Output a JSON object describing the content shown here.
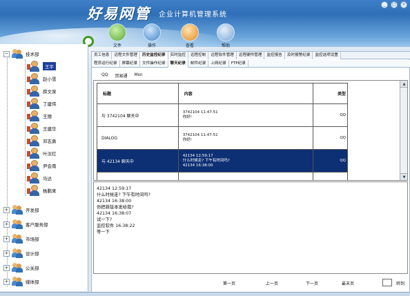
{
  "app": {
    "title": "好易网管",
    "subtitle": "企业计算机管理系统"
  },
  "window_controls": [
    "_",
    "□",
    "×"
  ],
  "toolbar": [
    {
      "label": "文件",
      "icon": "file-icon",
      "color": "#5aa83a"
    },
    {
      "label": "操作",
      "icon": "operate-icon",
      "color": "#3d84c9"
    },
    {
      "label": "查看",
      "icon": "view-icon",
      "color": "#e58a22"
    },
    {
      "label": "帮助",
      "icon": "help-icon",
      "color": "#7aa6d6"
    }
  ],
  "sidebar": {
    "root": {
      "label": "技术部"
    },
    "members": [
      "王平",
      "赵小雪",
      "薛文泉",
      "丁建伟",
      "王丽",
      "王建华",
      "邓志勇",
      "叶汝红",
      "尹会南",
      "马达",
      "杨鹏来"
    ],
    "selected_member": "王平",
    "groups": [
      "开发部",
      "客户服务部",
      "市场部",
      "设计部",
      "公关部",
      "媒体部"
    ]
  },
  "tabs_primary": [
    {
      "label": "员工信息",
      "active": false
    },
    {
      "label": "远程文件管理",
      "active": false
    },
    {
      "label": "历史监控纪录",
      "active": true
    },
    {
      "label": "实时监控",
      "active": false
    },
    {
      "label": "远程控制",
      "active": false
    },
    {
      "label": "远程软件管理",
      "active": false
    },
    {
      "label": "远程硬件管理",
      "active": false
    },
    {
      "label": "监控报告",
      "active": false
    },
    {
      "label": "及时报警纪录",
      "active": false
    },
    {
      "label": "监控选项设置",
      "active": false
    }
  ],
  "tabs_secondary": [
    {
      "label": "程序运行纪录",
      "active": false
    },
    {
      "label": "屏幕纪录",
      "active": false
    },
    {
      "label": "文件操作纪录",
      "active": false
    },
    {
      "label": "聊天纪录",
      "active": true
    },
    {
      "label": "邮件纪录",
      "active": false
    },
    {
      "label": "上网纪录",
      "active": false
    },
    {
      "label": "FTP纪录",
      "active": false
    }
  ],
  "tabs_tertiary": [
    "QQ",
    "贸易通",
    "Msn"
  ],
  "table": {
    "headers": [
      "标题",
      "内容",
      "类型"
    ],
    "rows": [
      {
        "title": "与 3742104 聊天中",
        "content": [
          "3742104 11:47:51",
          "你好!"
        ],
        "type": "QQ",
        "selected": false
      },
      {
        "title": "DIALOG",
        "content": [
          "3742104 11:47:51",
          "你好!"
        ],
        "type": "QQ",
        "selected": false
      },
      {
        "title": "与 42134 聊天中",
        "content": [
          "42134 12:59:17",
          "什么时候走? 下午有时间吗?",
          "42134 16:38:00"
        ],
        "type": "QQ",
        "selected": true
      }
    ]
  },
  "detail": {
    "lines": [
      "42134 12:59:17",
      "什么时候走? 下午有时间吗?",
      "42134 16:38:00",
      "你把新版本发给我?",
      "42134 16:38:07",
      "试一下?",
      "监控软件 16:38:22",
      "等一下"
    ]
  },
  "pager": {
    "first": "第一页",
    "prev": "上一页",
    "next": "下一页",
    "last": "最末页",
    "goto": "转到"
  }
}
